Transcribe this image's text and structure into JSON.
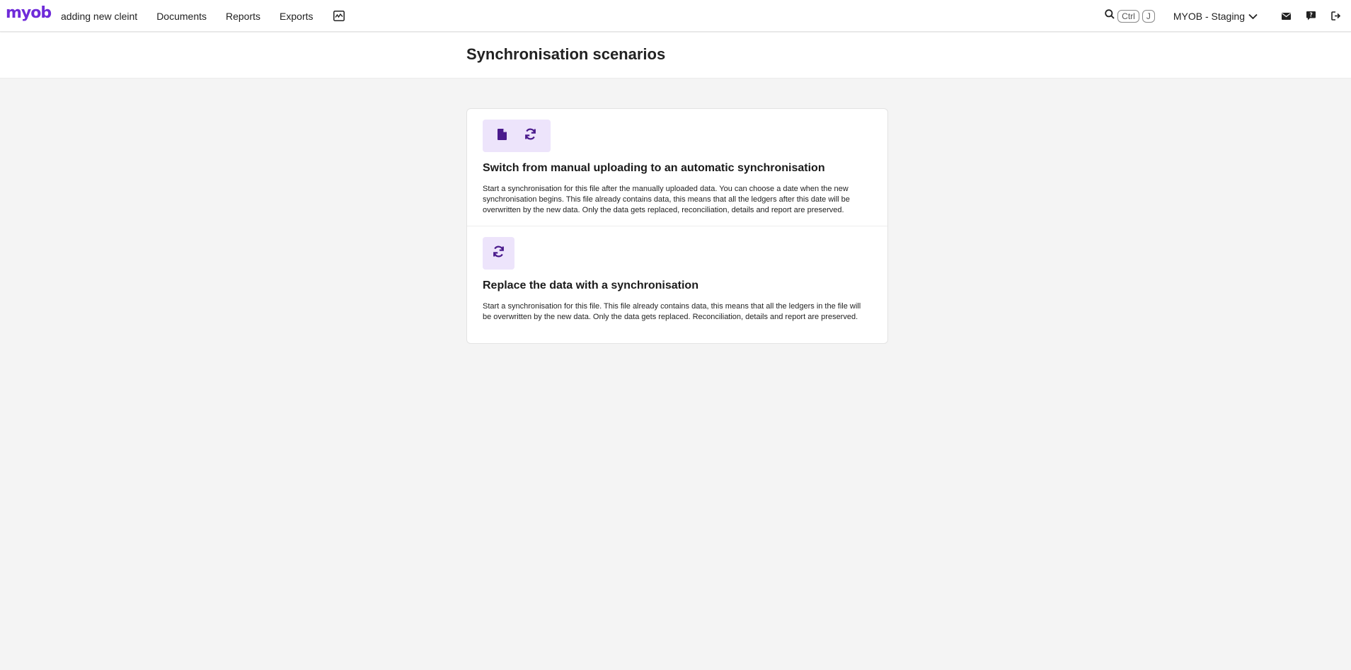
{
  "app": {
    "logo_text": "myob",
    "brand_color": "#6f2bd9"
  },
  "nav": {
    "items": [
      {
        "label": "adding new cleint"
      },
      {
        "label": "Documents"
      },
      {
        "label": "Reports"
      },
      {
        "label": "Exports"
      }
    ],
    "chart_icon": "chart-icon"
  },
  "toolbar": {
    "search_icon": "search-icon",
    "shortcut_keys": [
      "Ctrl",
      "J"
    ],
    "environment_label": "MYOB - Staging",
    "icons": [
      "mail-icon",
      "feedback-icon",
      "logout-icon"
    ]
  },
  "page": {
    "title": "Synchronisation scenarios"
  },
  "scenarios": [
    {
      "icons": [
        "file-icon",
        "sync-icon"
      ],
      "title": "Switch from manual uploading to an automatic synchronisation",
      "description": "Start a synchronisation for this file after the manually uploaded data. You can choose a date when the new synchronisation begins. This file already contains data, this means that all the ledgers after this date will be overwritten by the new data. Only the data gets replaced, reconciliation, details and report are preserved."
    },
    {
      "icons": [
        "sync-icon"
      ],
      "title": "Replace the data with a synchronisation",
      "description": "Start a synchronisation for this file. This file already contains data, this means that all the ledgers in the file will be overwritten by the new data. Only the data gets replaced. Reconciliation, details and report are preserved."
    }
  ],
  "colors": {
    "icon_chip_bg": "#ede4fb",
    "icon_color": "#4a1a8c",
    "page_bg": "#f4f4f4"
  }
}
